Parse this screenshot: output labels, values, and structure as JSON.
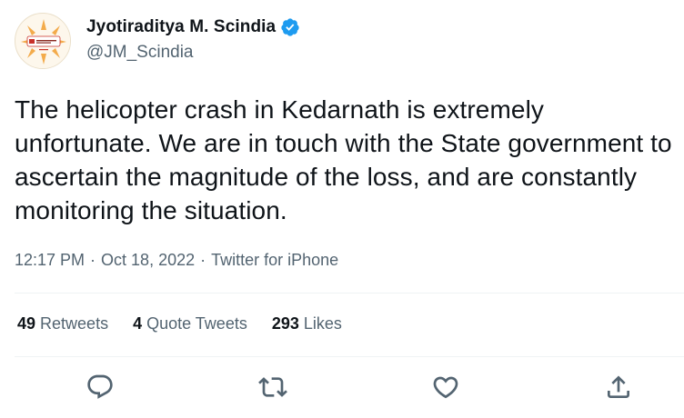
{
  "tweet": {
    "author": {
      "display_name": "Jyotiraditya M. Scindia",
      "handle": "@JM_Scindia",
      "verified": true,
      "verified_color": "#1d9bf0"
    },
    "text": "The helicopter crash in Kedarnath is extremely unfortunate. We are in touch with the State government to ascertain the magnitude of the loss, and are constantly monitoring the situation.",
    "time": "12:17 PM",
    "separator": "·",
    "date": "Oct 18, 2022",
    "source": "Twitter for iPhone"
  },
  "stats": {
    "retweets_count": "49",
    "retweets_label": "Retweets",
    "quotes_count": "4",
    "quotes_label": "Quote Tweets",
    "likes_count": "293",
    "likes_label": "Likes"
  },
  "actions": [
    {
      "name": "reply-icon"
    },
    {
      "name": "retweet-icon"
    },
    {
      "name": "like-icon"
    },
    {
      "name": "share-icon"
    }
  ],
  "colors": {
    "text_primary": "#0f1419",
    "text_secondary": "#536471",
    "divider": "#eff3f4",
    "icon": "#536471"
  }
}
